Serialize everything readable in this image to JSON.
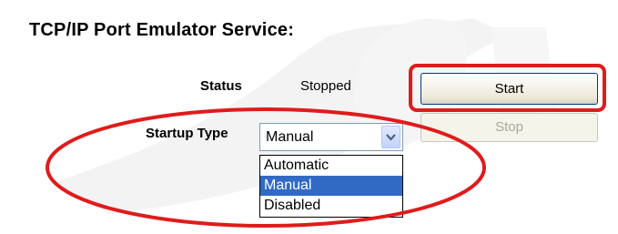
{
  "section": {
    "heading": "TCP/IP Port Emulator Service:"
  },
  "status": {
    "label": "Status",
    "value": "Stopped"
  },
  "startup_type": {
    "label": "Startup Type",
    "selected": "Manual",
    "options": [
      "Automatic",
      "Manual",
      "Disabled"
    ]
  },
  "buttons": {
    "start_label": "Start",
    "stop_label": "Stop"
  },
  "icons": {
    "dropdown_arrow": "chevron-down-icon"
  },
  "colors": {
    "annotation_red": "#e01b1b",
    "selection_blue": "#316ac5",
    "disabled_text": "#aca899"
  }
}
